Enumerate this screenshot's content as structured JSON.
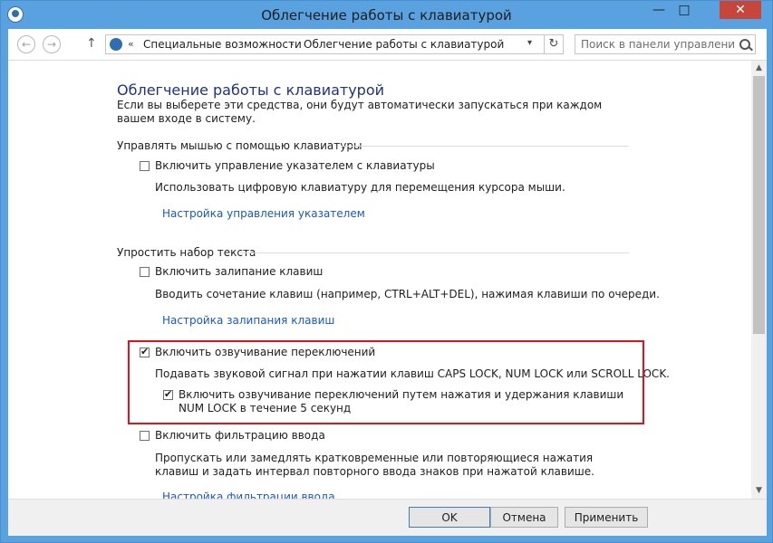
{
  "window": {
    "title": "Облегчение работы с клавиатурой",
    "controls": {
      "minimize": "—",
      "maximize": "□",
      "close": "✕"
    }
  },
  "nav": {
    "back_icon": "arrow-left-icon",
    "forward_icon": "arrow-right-icon",
    "up_icon": "arrow-up-icon",
    "breadcrumb_root_chevron": "«",
    "breadcrumb": [
      "Специальные возможности",
      "Облегчение работы с клавиатурой"
    ],
    "breadcrumb_separator": "›",
    "search_placeholder": "Поиск в панели управления"
  },
  "page": {
    "title": "Облегчение работы с клавиатурой",
    "description": "Если вы выберете эти средства, они будут автоматически запускаться при каждом вашем входе в систему.",
    "sections": [
      {
        "heading": "Управлять мышью с помощью клавиатуры",
        "items": [
          {
            "label": "Включить управление указателем с клавиатуры",
            "checked": false,
            "description": "Использовать цифровую клавиатуру для перемещения курсора мыши.",
            "link": "Настройка управления указателем"
          }
        ]
      },
      {
        "heading": "Упростить набор текста",
        "items": [
          {
            "label": "Включить залипание клавиш",
            "checked": false,
            "description": "Вводить сочетание клавиш (например, CTRL+ALT+DEL), нажимая клавиши по очереди.",
            "link": "Настройка залипания клавиш"
          },
          {
            "label": "Включить озвучивание переключений",
            "checked": true,
            "description": "Подавать звуковой сигнал при нажатии клавиш CAPS LOCK, NUM LOCK или SCROLL LOCK.",
            "sub_label": "Включить озвучивание переключений путем нажатия и удержания клавиши NUM LOCK в течение 5 секунд",
            "sub_checked": true
          },
          {
            "label": "Включить фильтрацию ввода",
            "checked": false,
            "description": "Пропускать или замедлять кратковременные или повторяющиеся нажатия клавиш и задать интервал повторного ввода знаков при нажатой клавише.",
            "link": "Настройка фильтрации ввода"
          }
        ]
      }
    ]
  },
  "buttons": {
    "ok": "OK",
    "cancel": "Отмена",
    "apply": "Применить"
  },
  "colors": {
    "title_bar": "#5aa1e0",
    "close_button": "#c7463b",
    "heading": "#1e3287",
    "link": "#1c57c4",
    "highlight_border": "#e2121d"
  }
}
